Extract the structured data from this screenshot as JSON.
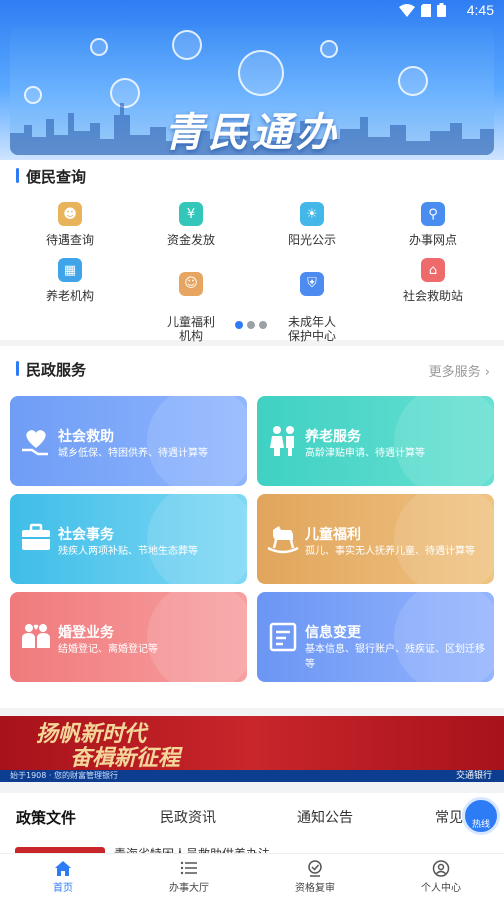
{
  "status_bar": {
    "time": "4:45"
  },
  "banner": {
    "title": "青民通办"
  },
  "convenience": {
    "title": "便民查询",
    "items": [
      {
        "label": "待遇查询",
        "color": "#e8b35a"
      },
      {
        "label": "资金发放",
        "color": "#33c7b9"
      },
      {
        "label": "阳光公示",
        "color": "#43b8e8"
      },
      {
        "label": "办事网点",
        "color": "#4a8df0"
      },
      {
        "label": "养老机构",
        "color": "#3fa4e8"
      },
      {
        "label": "儿童福利\n机构",
        "color": "#e7a562"
      },
      {
        "label": "未成年人\n保护中心",
        "color": "#4c8cf0"
      },
      {
        "label": "社会救助站",
        "color": "#ef6b6b"
      }
    ],
    "pager": {
      "count": 3,
      "active": 0
    }
  },
  "civil": {
    "title": "民政服务",
    "more": "更多服务",
    "tiles": [
      {
        "title": "社会救助",
        "desc": "城乡低保、特困供养、待遇计算等",
        "from": "#6f9df5",
        "to": "#8fb6ff"
      },
      {
        "title": "养老服务",
        "desc": "高龄津贴申请、待遇计算等",
        "from": "#3fd1c3",
        "to": "#67e0d2"
      },
      {
        "title": "社会事务",
        "desc": "残疾人两项补贴、节地生态葬等",
        "from": "#3fbde8",
        "to": "#7fd8f5"
      },
      {
        "title": "儿童福利",
        "desc": "孤儿、事实无人抚养儿童、待遇计算等",
        "from": "#e1a55c",
        "to": "#efc382"
      },
      {
        "title": "婚登业务",
        "desc": "结婚登记、离婚登记等",
        "from": "#f07a7c",
        "to": "#f7a0a1"
      },
      {
        "title": "信息变更",
        "desc": "基本信息、银行账户、残疾证、区划迁移等",
        "from": "#6b96f3",
        "to": "#94b4ff"
      }
    ]
  },
  "ad": {
    "slogan_line1": "扬帆新时代",
    "slogan_line2": "奋楫新征程",
    "footer": "始于1908 · 您的财富管理银行",
    "bank": "交通银行"
  },
  "news_tabs": {
    "tabs": [
      "政策文件",
      "民政资讯",
      "通知公告",
      "常见"
    ],
    "active": 0,
    "hotline": "热线"
  },
  "news": {
    "headline": "青海省特困人员救助供养办法"
  },
  "bottom_nav": {
    "items": [
      {
        "label": "首页",
        "icon": "home-icon"
      },
      {
        "label": "办事大厅",
        "icon": "list-icon"
      },
      {
        "label": "资格复审",
        "icon": "review-icon"
      },
      {
        "label": "个人中心",
        "icon": "user-icon"
      }
    ],
    "active": 0
  }
}
